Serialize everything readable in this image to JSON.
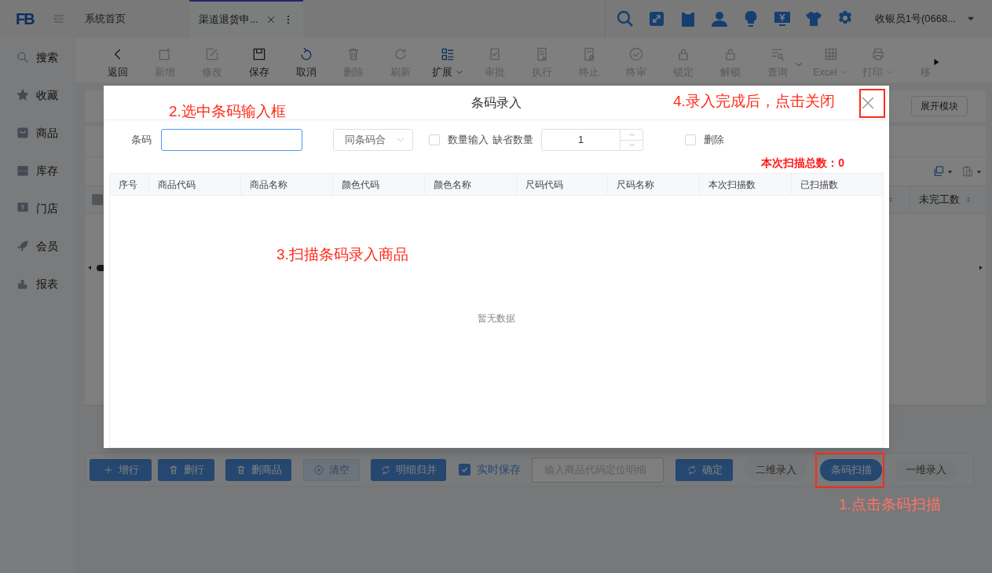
{
  "header": {
    "logo": "FB",
    "tabs": [
      {
        "label": "系统首页",
        "selected": false
      },
      {
        "label": "渠道退货申...",
        "selected": true
      }
    ],
    "user": "收银员1号(0668..."
  },
  "sidebar": {
    "items": [
      {
        "label": "搜索"
      },
      {
        "label": "收藏"
      },
      {
        "label": "商品"
      },
      {
        "label": "库存"
      },
      {
        "label": "门店"
      },
      {
        "label": "会员"
      },
      {
        "label": "报表"
      }
    ]
  },
  "toolbar": {
    "items": [
      {
        "kind": "button",
        "label": "返回",
        "disabled": false,
        "dropdown": false
      },
      {
        "kind": "button",
        "label": "新增",
        "disabled": true,
        "dropdown": false
      },
      {
        "kind": "button",
        "label": "修改",
        "disabled": true,
        "dropdown": false
      },
      {
        "kind": "button",
        "label": "保存",
        "disabled": false,
        "dropdown": false
      },
      {
        "kind": "button",
        "label": "取消",
        "disabled": false,
        "dropdown": false
      },
      {
        "kind": "button",
        "label": "删除",
        "disabled": true,
        "dropdown": false
      },
      {
        "kind": "button",
        "label": "刷新",
        "disabled": true,
        "dropdown": false
      },
      {
        "kind": "button",
        "label": "扩展",
        "disabled": false,
        "dropdown": true
      },
      {
        "kind": "button",
        "label": "审批",
        "disabled": true,
        "dropdown": false
      },
      {
        "kind": "button",
        "label": "执行",
        "disabled": true,
        "dropdown": false
      },
      {
        "kind": "button",
        "label": "终止",
        "disabled": true,
        "dropdown": false
      },
      {
        "kind": "button",
        "label": "终审",
        "disabled": true,
        "dropdown": false
      },
      {
        "kind": "button",
        "label": "锁定",
        "disabled": true,
        "dropdown": false
      },
      {
        "kind": "button",
        "label": "解锁",
        "disabled": true,
        "dropdown": false
      },
      {
        "kind": "button",
        "label": "查询",
        "disabled": true,
        "dropdown": false
      },
      {
        "kind": "toggle"
      },
      {
        "kind": "button",
        "label": "Excel",
        "disabled": true,
        "dropdown": true
      },
      {
        "kind": "button",
        "label": "打印",
        "disabled": true,
        "dropdown": true
      },
      {
        "kind": "text",
        "label": "移",
        "disabled": true,
        "dropdown": false
      }
    ]
  },
  "page": {
    "expand_button": "展开模块",
    "select_all": {
      "checked": false
    },
    "column_header": "未完工数"
  },
  "bottom_toolbar": {
    "items": [
      {
        "kind": "button",
        "label": "增行",
        "disabled": false
      },
      {
        "kind": "button",
        "label": "删行",
        "disabled": false
      },
      {
        "kind": "button",
        "label": "删商品",
        "disabled": false
      },
      {
        "kind": "button",
        "label": "清空",
        "disabled": true
      },
      {
        "kind": "button",
        "label": "明细归并",
        "disabled": false
      },
      {
        "kind": "checkbox",
        "label": "实时保存",
        "checked": true
      },
      {
        "kind": "input",
        "placeholder": "输入商品代码定位明细"
      },
      {
        "kind": "button",
        "label": "确定",
        "disabled": false
      },
      {
        "kind": "pill",
        "label": "二维录入",
        "selected": false
      },
      {
        "kind": "pill",
        "label": "条码扫描",
        "selected": true
      },
      {
        "kind": "pill",
        "label": "一维录入",
        "selected": false
      }
    ]
  },
  "dialog": {
    "title": "条码录入",
    "barcode_label": "条码",
    "barcode_focused": true,
    "merge_select": "同条码合",
    "qty_checkbox": {
      "label": "数量输入",
      "checked": false
    },
    "default_qty_label": "缺省数量",
    "default_qty": "1",
    "delete_checkbox": {
      "label": "删除",
      "checked": false
    },
    "scan_total": "本次扫描总数：0",
    "table": {
      "columns": [
        "序号",
        "商品代码",
        "商品名称",
        "颜色代码",
        "颜色名称",
        "尺码代码",
        "尺码名称",
        "本次扫描数",
        "已扫描数"
      ],
      "empty_text": "暂无数据"
    }
  },
  "annotations": [
    {
      "text": "1.点击条码扫描",
      "framed": true
    },
    {
      "text": "2.选中条码输入框",
      "framed": false
    },
    {
      "text": "3.扫描条码录入商品",
      "framed": false
    },
    {
      "text": "4.录入完成后，点击关闭",
      "framed": true
    }
  ]
}
